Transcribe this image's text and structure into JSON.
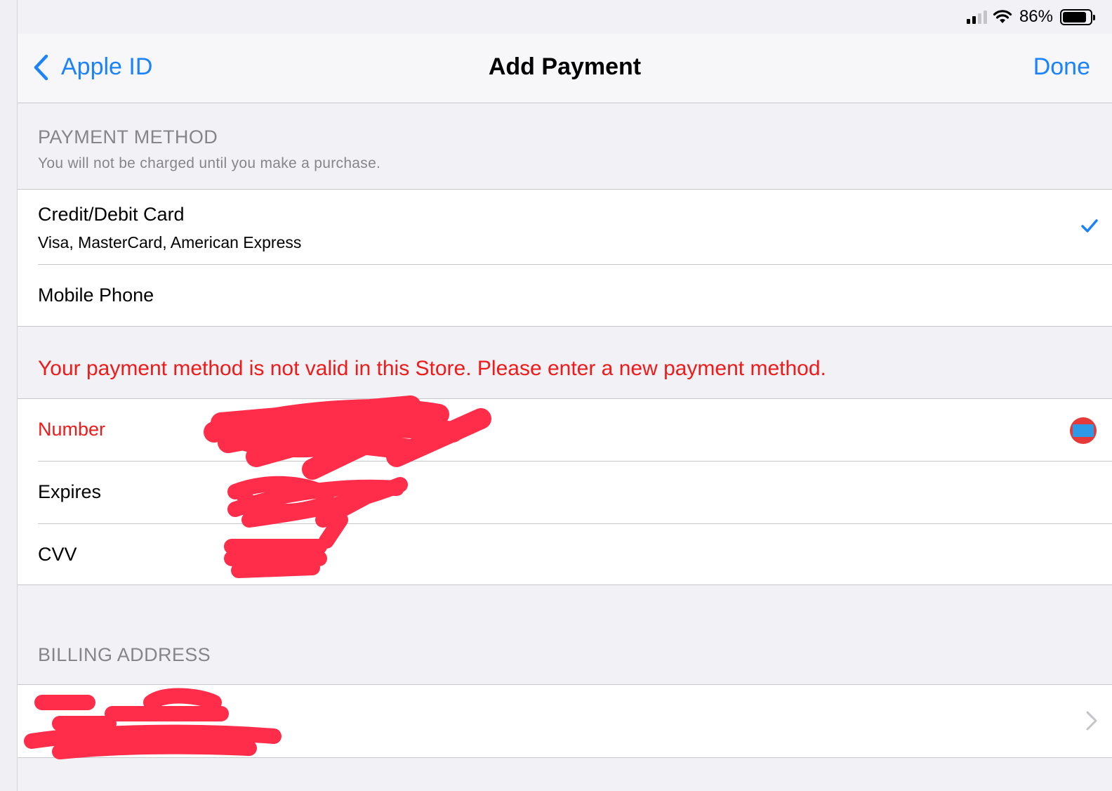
{
  "status_bar": {
    "battery_percent": "86%",
    "battery_level": 0.86,
    "signal_bars_active": 2,
    "signal_bars_total": 4
  },
  "nav": {
    "back_label": "Apple ID",
    "title": "Add Payment",
    "done_label": "Done"
  },
  "payment_method": {
    "header": "PAYMENT METHOD",
    "subheader": "You will not be charged until you make a purchase.",
    "options": [
      {
        "title": "Credit/Debit Card",
        "subtitle": "Visa, MasterCard, American Express",
        "selected": true
      },
      {
        "title": "Mobile Phone",
        "subtitle": "",
        "selected": false
      }
    ]
  },
  "error_message": "Your payment method is not valid in this Store. Please enter a new payment method.",
  "card_fields": {
    "number_label": "Number",
    "expires_label": "Expires",
    "cvv_label": "CVV",
    "card_icon": "amex-card-icon"
  },
  "billing": {
    "header": "BILLING ADDRESS"
  },
  "colors": {
    "accent": "#1a82fb",
    "error": "#ef1a1a",
    "redaction": "#ff2d4a",
    "background": "#f1f1f6"
  }
}
